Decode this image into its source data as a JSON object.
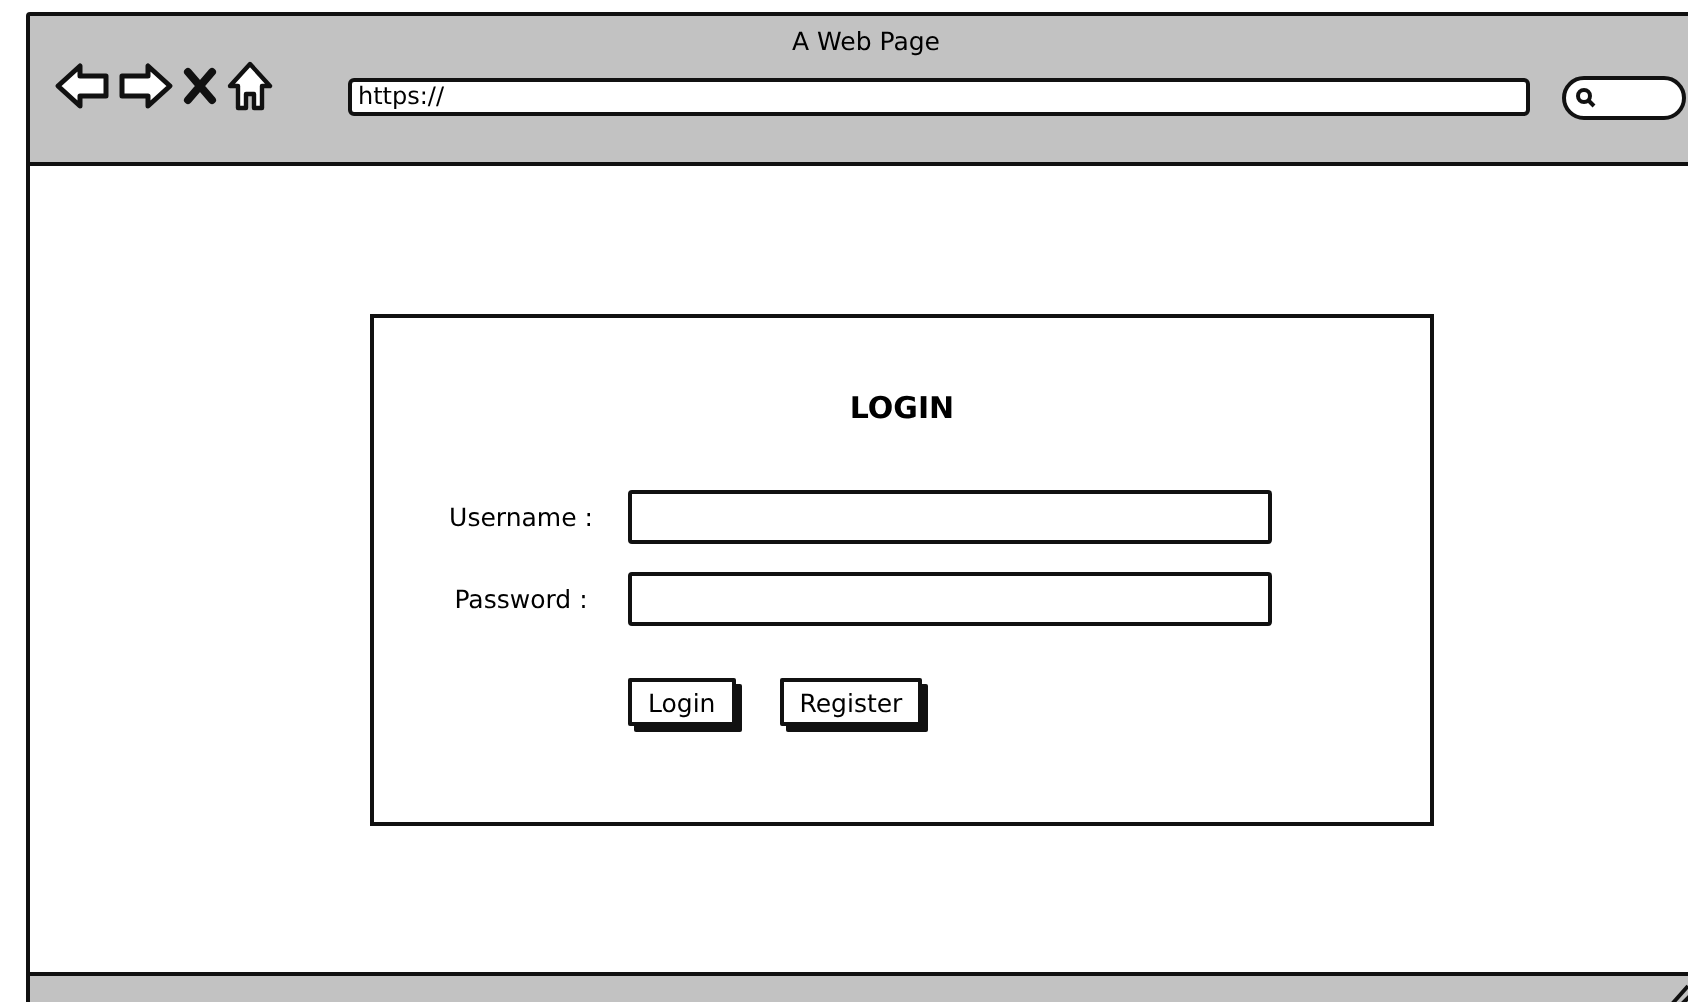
{
  "window": {
    "title": "A Web Page"
  },
  "address_bar": {
    "value": "https://"
  },
  "login": {
    "title": "LOGIN",
    "fields": [
      {
        "label": "Username :"
      },
      {
        "label": "Password :"
      }
    ],
    "buttons": [
      "Login",
      "Register"
    ]
  }
}
